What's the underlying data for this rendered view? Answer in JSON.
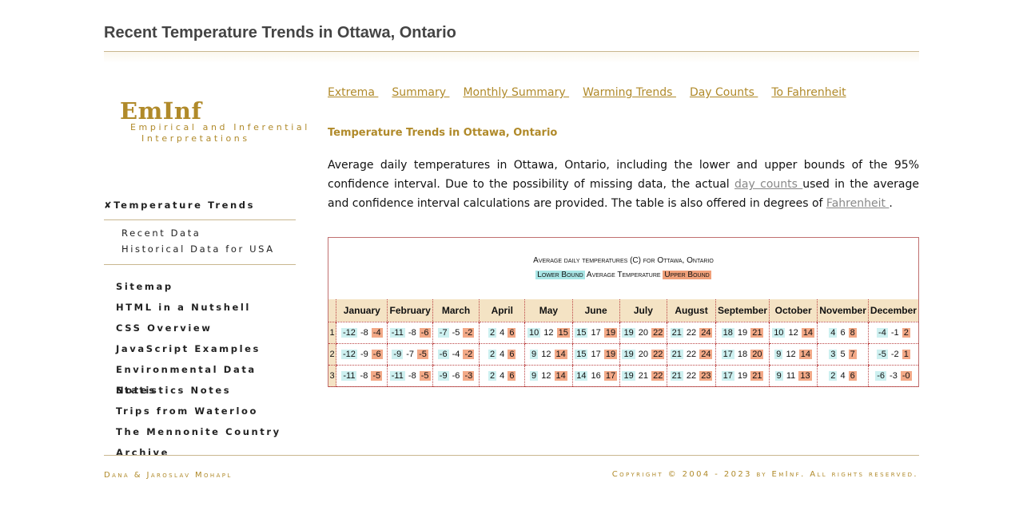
{
  "page": {
    "title": "Recent Temperature Trends in Ottawa, Ontario"
  },
  "branding": {
    "logo": "EmInf",
    "tagline_line1": "Empirical and Inferential",
    "tagline_line2": "Interpretations"
  },
  "sidebar": {
    "heading": "✘Temperature Trends",
    "sub_items": [
      "Recent Data",
      "Historical Data for USA"
    ],
    "items": [
      "Sitemap",
      "HTML in a Nutshell",
      "CSS Overview",
      "JavaScript Examples",
      "Environmental Data Notes",
      "Statistics Notes",
      "Trips from Waterloo",
      "The Mennonite Country",
      "Archive"
    ]
  },
  "topnav": [
    "Extrema ",
    "Summary ",
    "Monthly Summary ",
    "Warming Trends ",
    "Day Counts ",
    "To Fahrenheit"
  ],
  "section_title": "Temperature Trends in Ottawa, Ontario",
  "intro": {
    "text1": "Average daily temperatures in Ottawa, Ontario, including the lower and upper bounds of the 95% confidence interval. Due to the possibility of missing data, the actual ",
    "link1": "day counts ",
    "text2": "used in the average and confidence interval calculations are provided. The table is also offered in degrees of ",
    "link2": "Fahrenheit ",
    "text3": "."
  },
  "table": {
    "caption": "Average daily temperatures (C) for Ottawa, Ontario",
    "legend_lower": "Lower Bound",
    "legend_avg": "Average Temperature",
    "legend_upper": "Upper Bound",
    "months": [
      "January",
      "February",
      "March",
      "April",
      "May",
      "June",
      "July",
      "August",
      "September",
      "October",
      "November",
      "December"
    ],
    "rows": [
      {
        "day": "1",
        "cells": [
          [
            "-12",
            "-8",
            "-4"
          ],
          [
            "-11",
            "-8",
            "-6"
          ],
          [
            "-7",
            "-5",
            "-2"
          ],
          [
            "2",
            "4",
            "6"
          ],
          [
            "10",
            "12",
            "15"
          ],
          [
            "15",
            "17",
            "19"
          ],
          [
            "19",
            "20",
            "22"
          ],
          [
            "21",
            "22",
            "24"
          ],
          [
            "18",
            "19",
            "21"
          ],
          [
            "10",
            "12",
            "14"
          ],
          [
            "4",
            "6",
            "8"
          ],
          [
            "-4",
            "-1",
            "2"
          ]
        ]
      },
      {
        "day": "2",
        "cells": [
          [
            "-12",
            "-9",
            "-6"
          ],
          [
            "-9",
            "-7",
            "-5"
          ],
          [
            "-6",
            "-4",
            "-2"
          ],
          [
            "2",
            "4",
            "6"
          ],
          [
            "9",
            "12",
            "14"
          ],
          [
            "15",
            "17",
            "19"
          ],
          [
            "19",
            "20",
            "22"
          ],
          [
            "21",
            "22",
            "24"
          ],
          [
            "17",
            "18",
            "20"
          ],
          [
            "9",
            "12",
            "14"
          ],
          [
            "3",
            "5",
            "7"
          ],
          [
            "-5",
            "-2",
            "1"
          ]
        ]
      },
      {
        "day": "3",
        "cells": [
          [
            "-11",
            "-8",
            "-5"
          ],
          [
            "-11",
            "-8",
            "-5"
          ],
          [
            "-9",
            "-6",
            "-3"
          ],
          [
            "2",
            "4",
            "6"
          ],
          [
            "9",
            "12",
            "14"
          ],
          [
            "14",
            "16",
            "17"
          ],
          [
            "19",
            "21",
            "22"
          ],
          [
            "21",
            "22",
            "23"
          ],
          [
            "17",
            "19",
            "21"
          ],
          [
            "9",
            "11",
            "13"
          ],
          [
            "2",
            "4",
            "6"
          ],
          [
            "-6",
            "-3",
            "-0"
          ]
        ]
      }
    ]
  },
  "footer": {
    "left": "Dana & Jaroslav Mohapl",
    "right": "Copyright © 2004 - 2023 by EmInf. All rights reserved."
  },
  "colors": {
    "accent": "#b08a2a",
    "lower_bound": "#cdf0f0",
    "upper_bound": "#f3a987",
    "header_bg": "#f4e3c4",
    "border": "#c07070"
  }
}
